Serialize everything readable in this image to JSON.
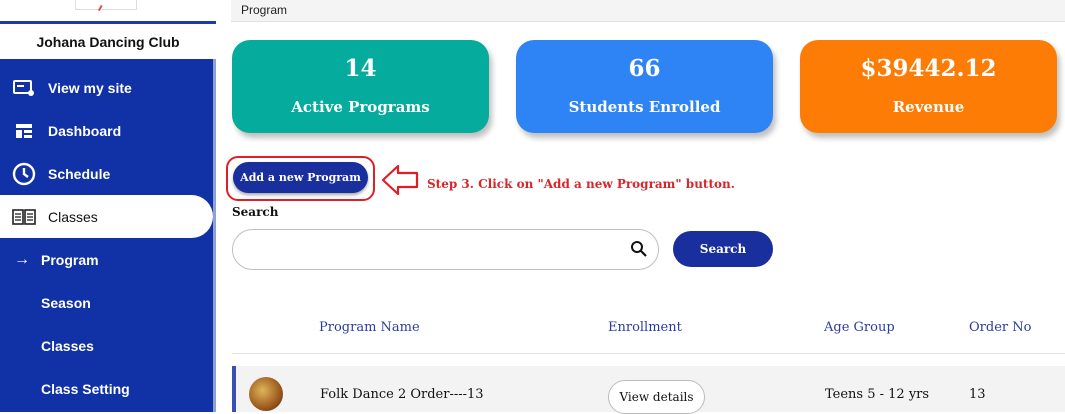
{
  "sidebar": {
    "club_name": "Johana Dancing Club",
    "items": [
      {
        "label": "View my site",
        "icon": "view-site-icon"
      },
      {
        "label": "Dashboard",
        "icon": "dashboard-icon"
      },
      {
        "label": "Schedule",
        "icon": "clock-icon"
      },
      {
        "label": "Classes",
        "icon": "book-icon"
      },
      {
        "label": "Program",
        "icon": "arrow-right-icon"
      }
    ],
    "subitems": [
      {
        "label": "Season"
      },
      {
        "label": "Classes"
      },
      {
        "label": "Class Setting"
      }
    ]
  },
  "breadcrumb": "Program",
  "stats": [
    {
      "value": "14",
      "label": "Active Programs",
      "color": "#05ab9c"
    },
    {
      "value": "66",
      "label": "Students Enrolled",
      "color": "#2e84f5"
    },
    {
      "value": "$39442.12",
      "label": "Revenue",
      "color": "#fd7c06"
    }
  ],
  "actions": {
    "add_program": "Add a new Program"
  },
  "annotation": {
    "step_text": "Step 3. Click on \"Add a new Program\" button.",
    "color": "#d8262b"
  },
  "search": {
    "label": "Search",
    "placeholder": "",
    "button": "Search"
  },
  "table": {
    "headers": [
      "Program Name",
      "Enrollment",
      "Age Group",
      "Order No"
    ],
    "rows": [
      {
        "name": "Folk Dance 2 Order----13",
        "enrollment": "View details",
        "age_group": "Teens 5 - 12 yrs",
        "order_no": "13"
      }
    ]
  }
}
